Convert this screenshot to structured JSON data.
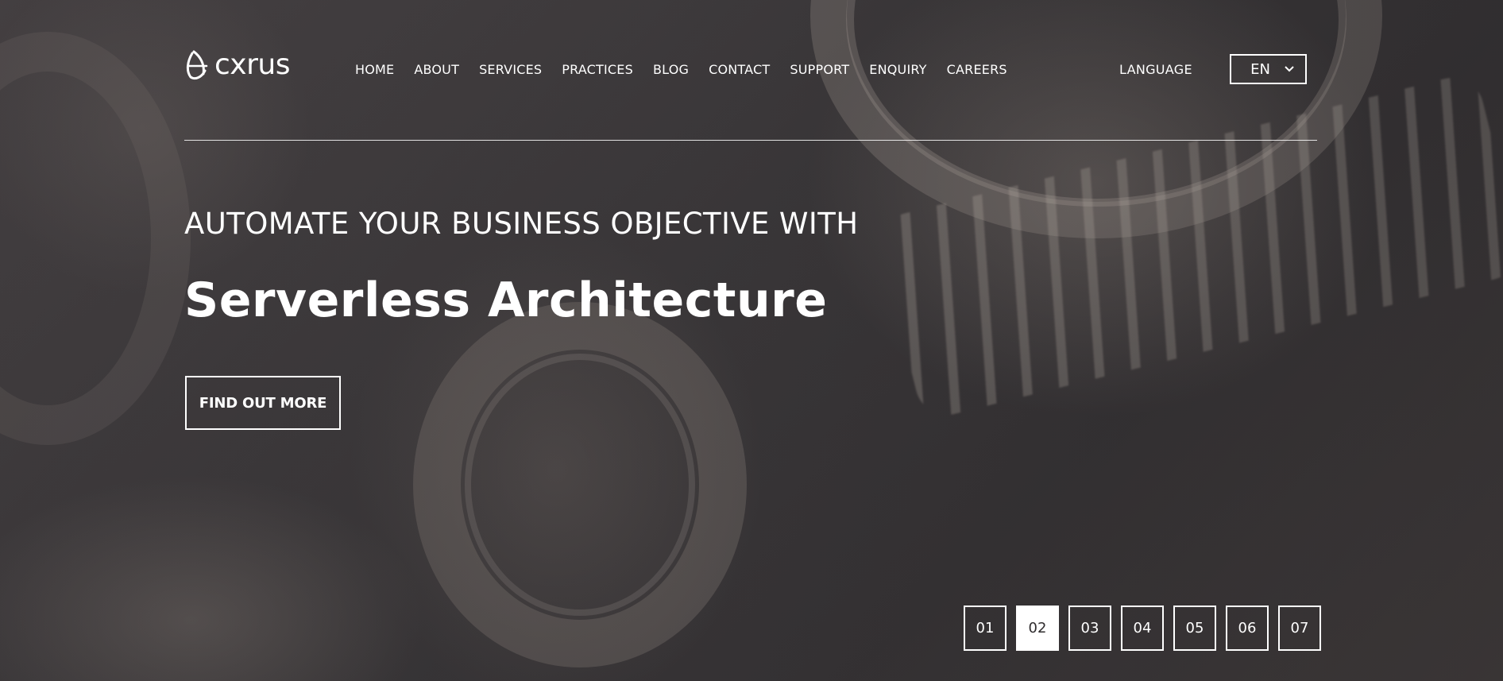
{
  "brand": {
    "logo_text": "cxrus"
  },
  "nav": {
    "items": [
      {
        "label": "HOME"
      },
      {
        "label": "ABOUT"
      },
      {
        "label": "SERVICES"
      },
      {
        "label": "PRACTICES"
      },
      {
        "label": "BLOG"
      },
      {
        "label": "CONTACT"
      },
      {
        "label": "SUPPORT"
      },
      {
        "label": "ENQUIRY"
      },
      {
        "label": "CAREERS"
      }
    ]
  },
  "language": {
    "label": "LANGUAGE",
    "selected": "EN"
  },
  "hero": {
    "subtitle": "AUTOMATE YOUR BUSINESS OBJECTIVE WITH",
    "headline": "Serverless Architecture",
    "cta_label": "FIND OUT MORE"
  },
  "slider": {
    "active_index": 1,
    "pages": [
      "01",
      "02",
      "03",
      "04",
      "05",
      "06",
      "07"
    ]
  },
  "colors": {
    "text": "#ffffff",
    "background": "#3c393b",
    "active_page_bg": "#ffffff",
    "active_page_text": "#2f2c2e"
  },
  "icons": {
    "logo_mark": "cxrus-logo-mark-icon",
    "language_dropdown": "chevron-down-icon"
  }
}
